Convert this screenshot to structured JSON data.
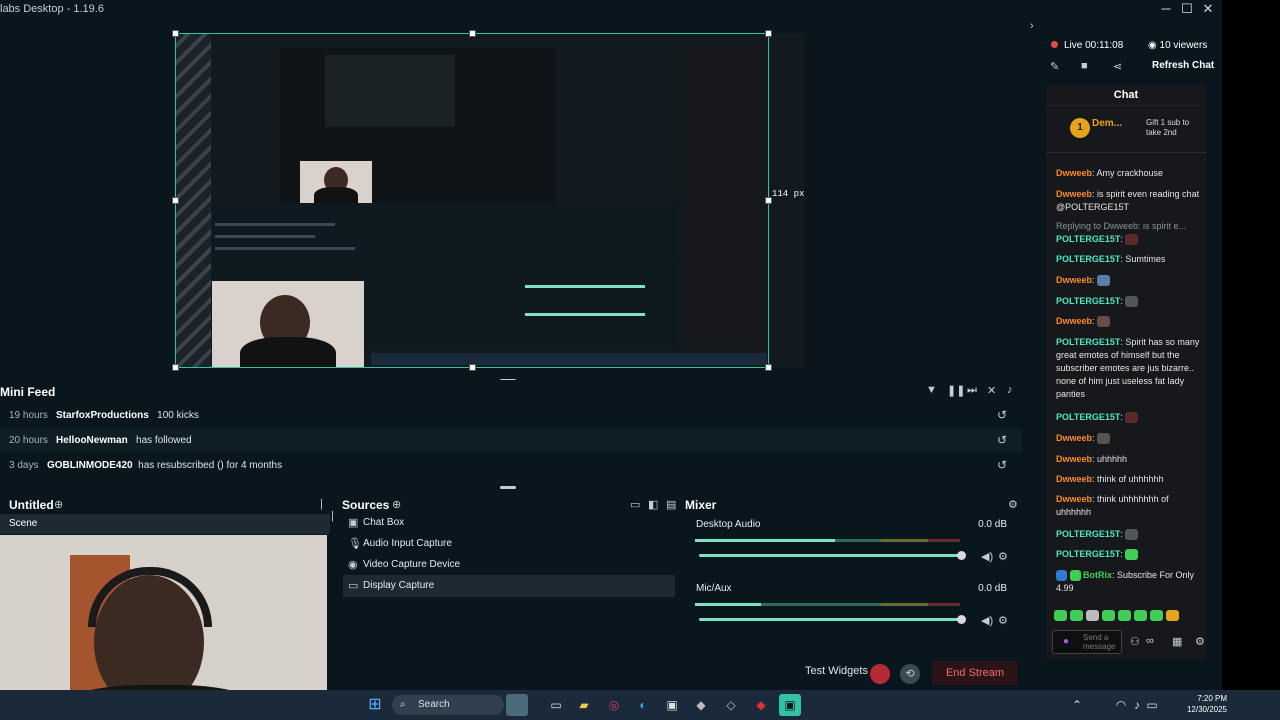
{
  "window": {
    "title": "labs Desktop - 1.19.6",
    "min": "─",
    "max": "☐",
    "close": "✕"
  },
  "preview": {
    "size_label": "114 px"
  },
  "minifeed": {
    "title": "Mini Feed",
    "rows": [
      {
        "ago": "19 hours",
        "name": "StarfoxProductions",
        "msg": "100 kicks"
      },
      {
        "ago": "20 hours",
        "name": "HellooNewman",
        "msg": "has followed"
      },
      {
        "ago": "3 days",
        "name": "GOBLINMODE420",
        "msg": "has resubscribed () for 4 months"
      }
    ]
  },
  "scenes": {
    "title": "Untitled",
    "item": "Scene"
  },
  "sources": {
    "title": "Sources",
    "items": [
      {
        "label": "Chat Box",
        "icon": "chat-icon"
      },
      {
        "label": "Audio Input Capture",
        "icon": "mic-icon"
      },
      {
        "label": "Video Capture Device",
        "icon": "camera-icon"
      },
      {
        "label": "Display Capture",
        "icon": "monitor-icon"
      }
    ]
  },
  "mixer": {
    "title": "Mixer",
    "channels": [
      {
        "label": "Desktop Audio",
        "db": "0.0 dB",
        "level": 0.53
      },
      {
        "label": "Mic/Aux",
        "db": "0.0 dB",
        "level": 0.25
      }
    ]
  },
  "footer": {
    "test_widgets": "Test Widgets",
    "end_stream": "End Stream"
  },
  "stream": {
    "live": "Live 00:11:08",
    "viewers": "10 viewers",
    "refresh_chat": "Refresh Chat"
  },
  "chat": {
    "title": "Chat",
    "pinned_user": "Dem...",
    "pinned_count": "1",
    "gift": "Gift 1 sub to take 2nd",
    "messages": [
      {
        "user": "Dwweeb",
        "text": ": Amy crackhouse"
      },
      {
        "user": "Dwweeb",
        "text": ": is spirit even reading chat @POLTERGE15T"
      },
      {
        "user": "",
        "text": "Replying to Dwweeb: is spirit e..."
      },
      {
        "user": "POLTERGE15T",
        "text": ":"
      },
      {
        "user": "POLTERGE15T",
        "text": ": Sumtimes"
      },
      {
        "user": "Dwweeb",
        "text": ":"
      },
      {
        "user": "POLTERGE15T",
        "text": ":"
      },
      {
        "user": "Dwweeb",
        "text": ":"
      },
      {
        "user": "POLTERGE15T",
        "text": ": Spirit has so many great emotes of himself but the subscriber emotes are jus bizarre.. none of him just useless fat lady panties"
      },
      {
        "user": "POLTERGE15T",
        "text": ":"
      },
      {
        "user": "Dwweeb",
        "text": ":"
      },
      {
        "user": "Dwweeb",
        "text": ": uhhhhh"
      },
      {
        "user": "Dwweeb",
        "text": ": think of uhhhhhh"
      },
      {
        "user": "Dwweeb",
        "text": ": think uhhhhhhh of uhhhhhh"
      },
      {
        "user": "POLTERGE15T",
        "text": ":"
      },
      {
        "user": "POLTERGE15T",
        "text": ":"
      },
      {
        "user": "BotRix",
        "text": ": Subscribe For Only 4.99"
      }
    ],
    "input_placeholder": "Send a message"
  },
  "taskbar": {
    "search": "Search",
    "time": "7:20 PM",
    "date": "12/30/2025"
  }
}
